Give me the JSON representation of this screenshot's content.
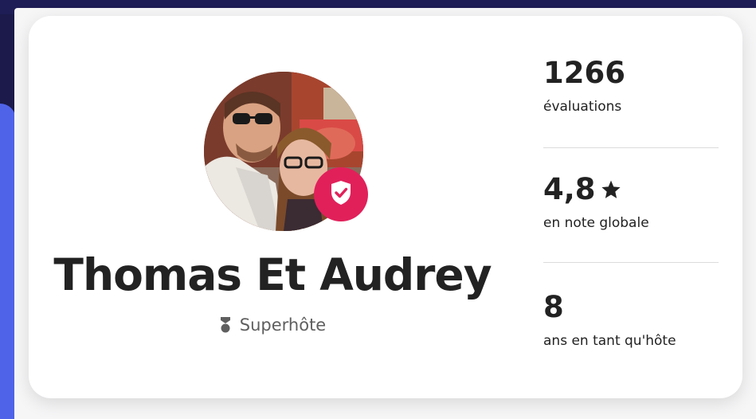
{
  "host": {
    "name": "Thomas Et Audrey",
    "badge_label": "Superhôte",
    "verified_icon": "shield-check-icon",
    "superhost_icon": "superhost-trophy-icon"
  },
  "stats": [
    {
      "value": "1266",
      "label": "évaluations"
    },
    {
      "value": "4,8",
      "label": "en note globale",
      "icon": "star-icon"
    },
    {
      "value": "8",
      "label": "ans en tant qu'hôte"
    }
  ],
  "colors": {
    "accent": "#e1205a",
    "text": "#222222",
    "muted": "#5f5f5f"
  }
}
